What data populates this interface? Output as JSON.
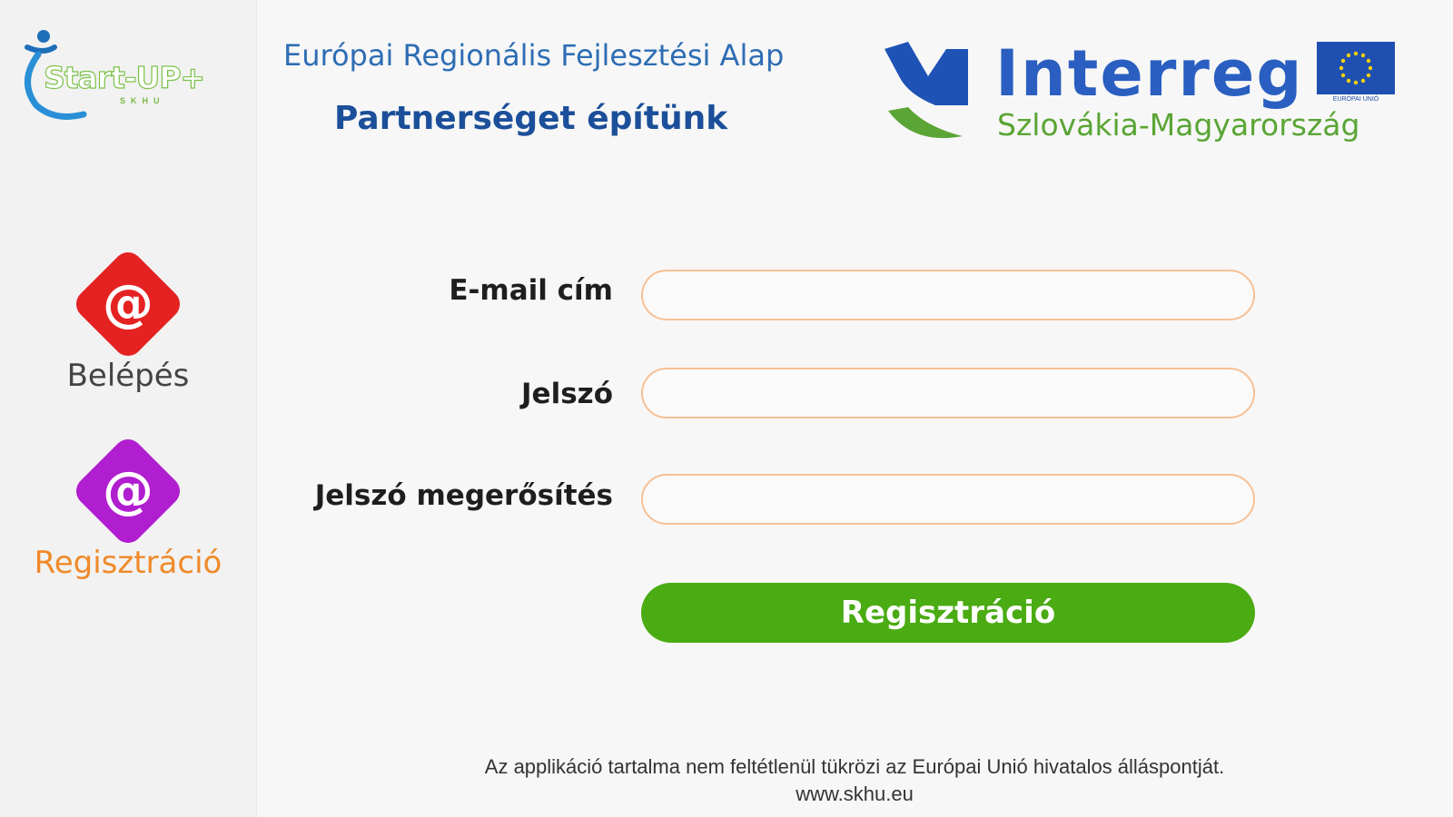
{
  "sidebar": {
    "logo": {
      "wordmark": "Start-UP+",
      "subword": "SKHU"
    },
    "items": [
      {
        "label": "Belépés",
        "icon": "at-icon",
        "color": "#e52222",
        "label_color": "#444444"
      },
      {
        "label": "Regisztráció",
        "icon": "at-icon",
        "color": "#b01ed0",
        "label_color": "#f08a2a"
      }
    ]
  },
  "header": {
    "line1": "Európai Regionális Fejlesztési Alap",
    "line2": "Partnerséget építünk",
    "interreg": {
      "title": "Interreg",
      "subtitle": "Szlovákia-Magyarország",
      "eu_caption": "EURÓPAI UNIÓ"
    }
  },
  "form": {
    "email_label": "E-mail cím",
    "email_value": "",
    "password_label": "Jelszó",
    "password_value": "",
    "confirm_label": "Jelszó megerősítés",
    "confirm_value": "",
    "submit_label": "Regisztráció"
  },
  "footer": {
    "disclaimer": "Az applikáció tartalma nem feltétlenül tükrözi az Európai Unió hivatalos álláspontját.",
    "url": "www.skhu.eu"
  },
  "colors": {
    "accent_green": "#4aab13",
    "field_border": "#f6c196",
    "brand_blue": "#2a5fc1"
  }
}
